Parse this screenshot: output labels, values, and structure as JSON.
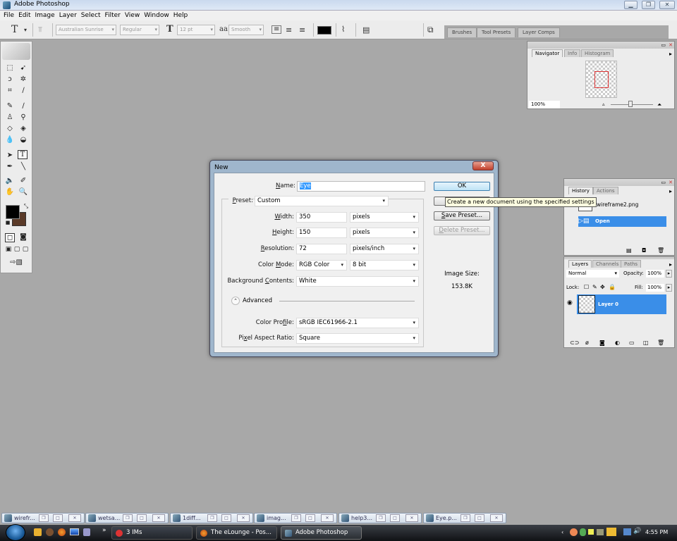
{
  "window": {
    "title": "Adobe Photoshop",
    "min_icon": "minimize-icon",
    "restore_icon": "restore-icon",
    "close_icon": "close-icon"
  },
  "menu": [
    "File",
    "Edit",
    "Image",
    "Layer",
    "Select",
    "Filter",
    "View",
    "Window",
    "Help"
  ],
  "options_bar": {
    "tool_icon": "T",
    "font_family": "Australian Sunrise",
    "font_style": "Regular",
    "font_size": "12 pt",
    "antialias_icon": "aa",
    "antialias": "Smooth",
    "text_color": "#000000"
  },
  "palette_well": {
    "tabs": [
      "Brushes",
      "Tool Presets",
      "Layer Comps"
    ]
  },
  "toolbox": {
    "fg_color": "#000000",
    "bg_color": "#5a3a28"
  },
  "navigator": {
    "tabs": [
      "Navigator",
      "Info",
      "Histogram"
    ],
    "zoom": "100%"
  },
  "history": {
    "tabs": [
      "History",
      "Actions"
    ],
    "snapshot": "wireframe2.png",
    "items": [
      "Open"
    ]
  },
  "layers": {
    "tabs": [
      "Layers",
      "Channels",
      "Paths"
    ],
    "blend_mode": "Normal",
    "opacity_label": "Opacity:",
    "opacity": "100%",
    "lock_label": "Lock:",
    "fill_label": "Fill:",
    "fill": "100%",
    "items": [
      "Layer 0"
    ]
  },
  "dialog": {
    "title": "New",
    "close_label": "X",
    "name_label": "Name:",
    "name_value": "Eye",
    "preset_label": "Preset:",
    "preset_value": "Custom",
    "width_label": "Width:",
    "width_value": "350",
    "width_unit": "pixels",
    "height_label": "Height:",
    "height_value": "150",
    "height_unit": "pixels",
    "resolution_label": "Resolution:",
    "resolution_value": "72",
    "resolution_unit": "pixels/inch",
    "color_mode_label": "Color Mode:",
    "color_mode_value": "RGB Color",
    "bit_depth": "8 bit",
    "bg_contents_label": "Background Contents:",
    "bg_contents_value": "White",
    "advanced_label": "Advanced",
    "color_profile_label": "Color Profile:",
    "color_profile_value": "sRGB IEC61966-2.1",
    "pixel_aspect_label": "Pixel Aspect Ratio:",
    "pixel_aspect_value": "Square",
    "ok_label": "OK",
    "save_preset_label": "Save Preset...",
    "delete_preset_label": "Delete Preset...",
    "image_size_label": "Image Size:",
    "image_size_value": "153.8K"
  },
  "tooltip": "Create a new document using the specified settings",
  "minimized_docs": [
    "wirefr...",
    "wetsa...",
    "1diff...",
    "imag...",
    "help3...",
    "Eye.p..."
  ],
  "taskbar": {
    "buttons": [
      "3 IMs",
      "The eLounge - Pos...",
      "Adobe Photoshop"
    ],
    "clock": "4:55 PM"
  }
}
